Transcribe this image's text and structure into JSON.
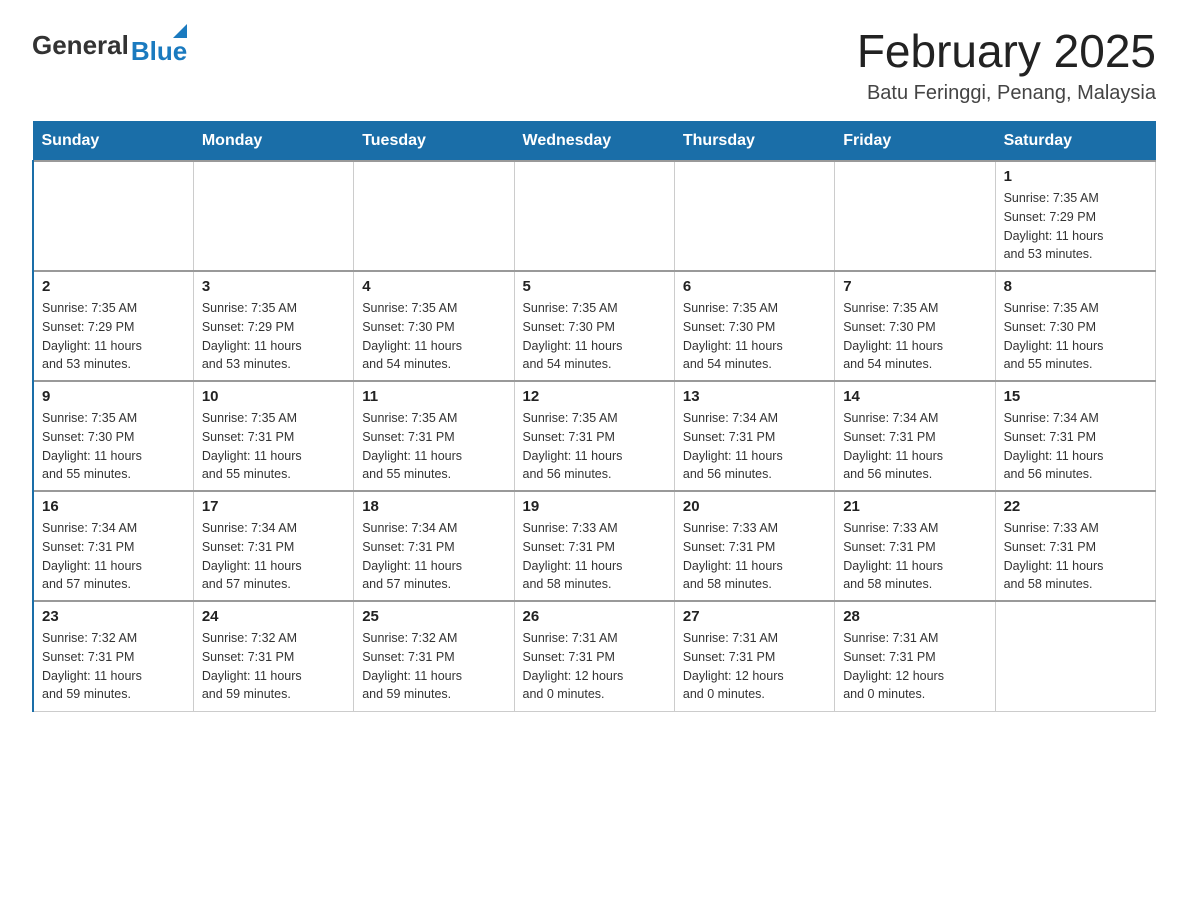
{
  "logo": {
    "general": "General",
    "blue": "Blue"
  },
  "header": {
    "title": "February 2025",
    "subtitle": "Batu Feringgi, Penang, Malaysia"
  },
  "weekdays": [
    "Sunday",
    "Monday",
    "Tuesday",
    "Wednesday",
    "Thursday",
    "Friday",
    "Saturday"
  ],
  "weeks": [
    [
      {
        "day": "",
        "info": ""
      },
      {
        "day": "",
        "info": ""
      },
      {
        "day": "",
        "info": ""
      },
      {
        "day": "",
        "info": ""
      },
      {
        "day": "",
        "info": ""
      },
      {
        "day": "",
        "info": ""
      },
      {
        "day": "1",
        "info": "Sunrise: 7:35 AM\nSunset: 7:29 PM\nDaylight: 11 hours\nand 53 minutes."
      }
    ],
    [
      {
        "day": "2",
        "info": "Sunrise: 7:35 AM\nSunset: 7:29 PM\nDaylight: 11 hours\nand 53 minutes."
      },
      {
        "day": "3",
        "info": "Sunrise: 7:35 AM\nSunset: 7:29 PM\nDaylight: 11 hours\nand 53 minutes."
      },
      {
        "day": "4",
        "info": "Sunrise: 7:35 AM\nSunset: 7:30 PM\nDaylight: 11 hours\nand 54 minutes."
      },
      {
        "day": "5",
        "info": "Sunrise: 7:35 AM\nSunset: 7:30 PM\nDaylight: 11 hours\nand 54 minutes."
      },
      {
        "day": "6",
        "info": "Sunrise: 7:35 AM\nSunset: 7:30 PM\nDaylight: 11 hours\nand 54 minutes."
      },
      {
        "day": "7",
        "info": "Sunrise: 7:35 AM\nSunset: 7:30 PM\nDaylight: 11 hours\nand 54 minutes."
      },
      {
        "day": "8",
        "info": "Sunrise: 7:35 AM\nSunset: 7:30 PM\nDaylight: 11 hours\nand 55 minutes."
      }
    ],
    [
      {
        "day": "9",
        "info": "Sunrise: 7:35 AM\nSunset: 7:30 PM\nDaylight: 11 hours\nand 55 minutes."
      },
      {
        "day": "10",
        "info": "Sunrise: 7:35 AM\nSunset: 7:31 PM\nDaylight: 11 hours\nand 55 minutes."
      },
      {
        "day": "11",
        "info": "Sunrise: 7:35 AM\nSunset: 7:31 PM\nDaylight: 11 hours\nand 55 minutes."
      },
      {
        "day": "12",
        "info": "Sunrise: 7:35 AM\nSunset: 7:31 PM\nDaylight: 11 hours\nand 56 minutes."
      },
      {
        "day": "13",
        "info": "Sunrise: 7:34 AM\nSunset: 7:31 PM\nDaylight: 11 hours\nand 56 minutes."
      },
      {
        "day": "14",
        "info": "Sunrise: 7:34 AM\nSunset: 7:31 PM\nDaylight: 11 hours\nand 56 minutes."
      },
      {
        "day": "15",
        "info": "Sunrise: 7:34 AM\nSunset: 7:31 PM\nDaylight: 11 hours\nand 56 minutes."
      }
    ],
    [
      {
        "day": "16",
        "info": "Sunrise: 7:34 AM\nSunset: 7:31 PM\nDaylight: 11 hours\nand 57 minutes."
      },
      {
        "day": "17",
        "info": "Sunrise: 7:34 AM\nSunset: 7:31 PM\nDaylight: 11 hours\nand 57 minutes."
      },
      {
        "day": "18",
        "info": "Sunrise: 7:34 AM\nSunset: 7:31 PM\nDaylight: 11 hours\nand 57 minutes."
      },
      {
        "day": "19",
        "info": "Sunrise: 7:33 AM\nSunset: 7:31 PM\nDaylight: 11 hours\nand 58 minutes."
      },
      {
        "day": "20",
        "info": "Sunrise: 7:33 AM\nSunset: 7:31 PM\nDaylight: 11 hours\nand 58 minutes."
      },
      {
        "day": "21",
        "info": "Sunrise: 7:33 AM\nSunset: 7:31 PM\nDaylight: 11 hours\nand 58 minutes."
      },
      {
        "day": "22",
        "info": "Sunrise: 7:33 AM\nSunset: 7:31 PM\nDaylight: 11 hours\nand 58 minutes."
      }
    ],
    [
      {
        "day": "23",
        "info": "Sunrise: 7:32 AM\nSunset: 7:31 PM\nDaylight: 11 hours\nand 59 minutes."
      },
      {
        "day": "24",
        "info": "Sunrise: 7:32 AM\nSunset: 7:31 PM\nDaylight: 11 hours\nand 59 minutes."
      },
      {
        "day": "25",
        "info": "Sunrise: 7:32 AM\nSunset: 7:31 PM\nDaylight: 11 hours\nand 59 minutes."
      },
      {
        "day": "26",
        "info": "Sunrise: 7:31 AM\nSunset: 7:31 PM\nDaylight: 12 hours\nand 0 minutes."
      },
      {
        "day": "27",
        "info": "Sunrise: 7:31 AM\nSunset: 7:31 PM\nDaylight: 12 hours\nand 0 minutes."
      },
      {
        "day": "28",
        "info": "Sunrise: 7:31 AM\nSunset: 7:31 PM\nDaylight: 12 hours\nand 0 minutes."
      },
      {
        "day": "",
        "info": ""
      }
    ]
  ]
}
